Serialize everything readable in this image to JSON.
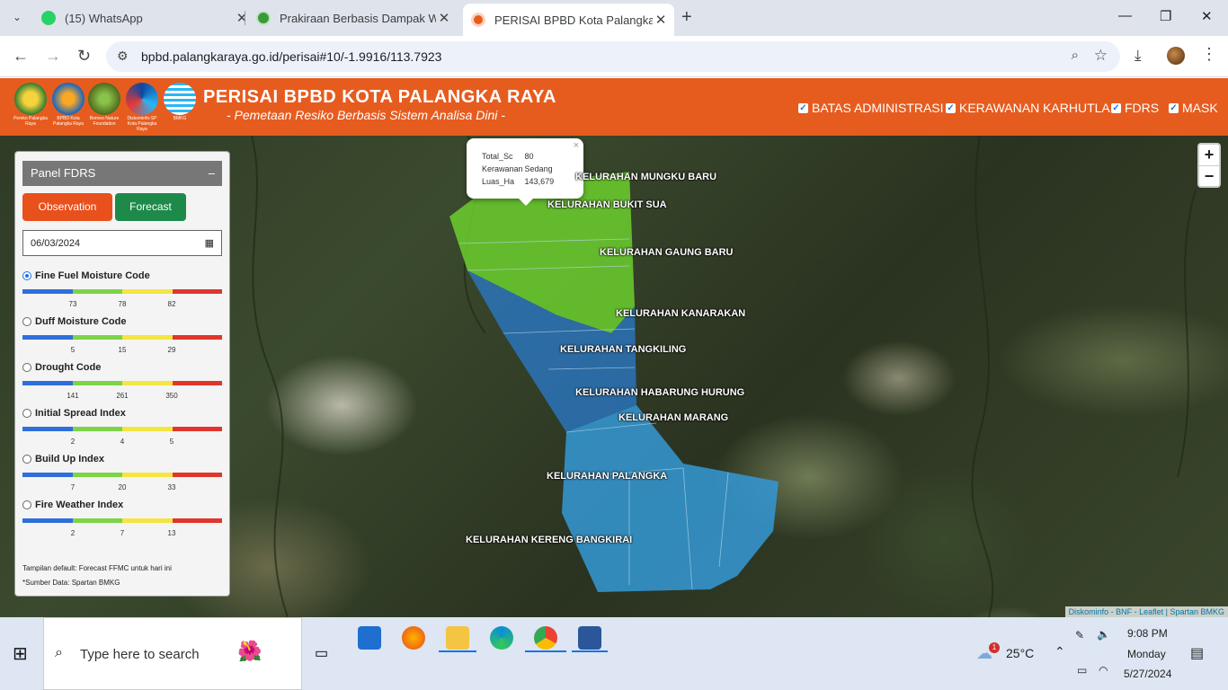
{
  "browser": {
    "tabs": [
      {
        "title": "(15) WhatsApp",
        "icon": "whatsapp-icon",
        "color": "#25d366"
      },
      {
        "title": "Prakiraan Berbasis Dampak Wil",
        "icon": "bmkg-icon",
        "color": "#3a9a3a"
      },
      {
        "title": "PERISAI BPBD Kota Palangka Ra",
        "icon": "bpbd-icon",
        "color": "#e65c1f"
      }
    ],
    "new_tab": "+",
    "url": "bpbd.palangkaraya.go.id/perisai#10/-1.9916/113.7923"
  },
  "header": {
    "title": "PERISAI BPBD KOTA PALANGKA RAYA",
    "subtitle": "- Pemetaan Resiko Berbasis Sistem Analisa Dini -",
    "logos": [
      {
        "caption": "Pemko Palangka Raya",
        "color": "#2e7d32"
      },
      {
        "caption": "BPBD Kota Palangka Raya",
        "color": "#1565c0"
      },
      {
        "caption": "Borneo Nature Foundation",
        "color": "#4e6b1e"
      },
      {
        "caption": "Diskominfo-SP Kota Palangka Raya",
        "color": "#0d47a1"
      },
      {
        "caption": "BMKG",
        "color": "#29b6f6"
      }
    ],
    "layers": [
      "BATAS ADMINISTRASI",
      "KERAWANAN KARHUTLA",
      "FDRS",
      "MASK"
    ]
  },
  "panel": {
    "title": "Panel FDRS",
    "minimize": "–",
    "observation_label": "Observation",
    "forecast_label": "Forecast",
    "date": "06/03/2024",
    "indices": [
      {
        "label": "Fine Fuel Moisture Code",
        "ticks": [
          "73",
          "78",
          "82"
        ],
        "selected": true
      },
      {
        "label": "Duff Moisture Code",
        "ticks": [
          "5",
          "15",
          "29"
        ],
        "selected": false
      },
      {
        "label": "Drought Code",
        "ticks": [
          "141",
          "261",
          "350"
        ],
        "selected": false
      },
      {
        "label": "Initial Spread Index",
        "ticks": [
          "2",
          "4",
          "5"
        ],
        "selected": false
      },
      {
        "label": "Build Up Index",
        "ticks": [
          "7",
          "20",
          "33"
        ],
        "selected": false
      },
      {
        "label": "Fire Weather Index",
        "ticks": [
          "2",
          "7",
          "13"
        ],
        "selected": false
      }
    ],
    "scale_colors": [
      "#2f6fdc",
      "#7ed348",
      "#f4e542",
      "#e0362c"
    ],
    "footer_default": "Tampilan default: Forecast FFMC untuk hari ini",
    "footer_source": "*Sumber Data: Spartan BMKG"
  },
  "map": {
    "popup": {
      "rows": [
        [
          "Total_Sc",
          "80"
        ],
        [
          "Kerawanan",
          "Sedang"
        ],
        [
          "Luas_Ha",
          "143,679"
        ]
      ],
      "close": "×"
    },
    "labels": [
      "KELURAHAN MUNGKU BARU",
      "KELURAHAN BUKIT SUA",
      "KELURAHAN GAUNG BARU",
      "KELURAHAN KANARAKAN",
      "KELURAHAN TANGKILING",
      "KELURAHAN HABARUNG HURUNG",
      "KELURAHAN MARANG",
      "KELURAHAN PALANGKA",
      "KELURAHAN KERENG BANGKIRAI"
    ],
    "zoom_in": "+",
    "zoom_out": "−",
    "attribution": "Diskominfo - BNF - Leaflet | Spartan BMKG"
  },
  "taskbar": {
    "search_placeholder": "Type here to search",
    "weather": "25°C",
    "weather_badge": "1",
    "time": "9:08 PM",
    "day": "Monday",
    "date": "5/27/2024"
  }
}
